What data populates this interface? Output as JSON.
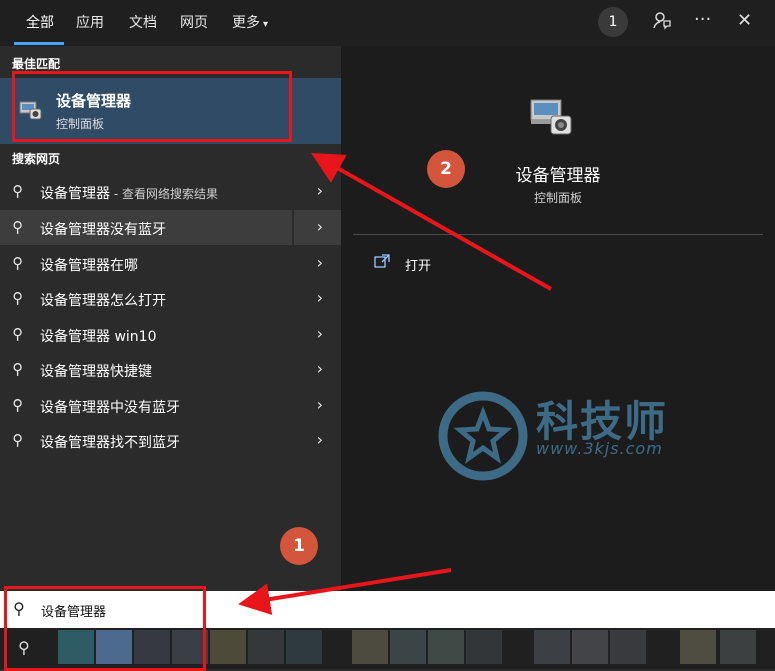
{
  "tabs": [
    "全部",
    "应用",
    "文档",
    "网页",
    "更多"
  ],
  "more_chevron": "▾",
  "header": {
    "count_badge": "1",
    "feedback_icon": "feedback-icon",
    "more_dots": "···",
    "close": "✕"
  },
  "sections": {
    "best_match": "最佳匹配",
    "web_search": "搜索网页"
  },
  "best_match": {
    "title": "设备管理器",
    "subtitle": "控制面板",
    "icon": "device-manager-icon"
  },
  "web_results": [
    {
      "text": "设备管理器",
      "suffix": " - 查看网络搜索结果"
    },
    {
      "text": "设备管理器没有蓝牙",
      "suffix": ""
    },
    {
      "text": "设备管理器在哪",
      "suffix": ""
    },
    {
      "text": "设备管理器怎么打开",
      "suffix": ""
    },
    {
      "text": "设备管理器 win10",
      "suffix": ""
    },
    {
      "text": "设备管理器快捷键",
      "suffix": ""
    },
    {
      "text": "设备管理器中没有蓝牙",
      "suffix": ""
    },
    {
      "text": "设备管理器找不到蓝牙",
      "suffix": ""
    }
  ],
  "preview": {
    "title": "设备管理器",
    "subtitle": "控制面板",
    "open_label": "打开"
  },
  "search": {
    "value": "设备管理器"
  },
  "watermark": {
    "text": "科技师",
    "url": "www.3kjs.com"
  },
  "annotations": {
    "badge1": "1",
    "badge2": "2"
  },
  "colors": {
    "accent": "#4aa3ff",
    "best_match_bg": "#2f4b66",
    "highlight": "#e8161b",
    "badge": "#d2553c"
  }
}
